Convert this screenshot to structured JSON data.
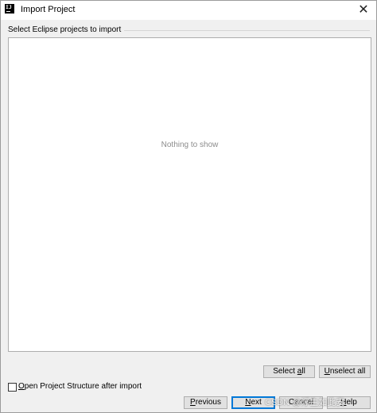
{
  "window": {
    "title": "Import Project",
    "app_icon_text": "IJ",
    "close_glyph": "✕"
  },
  "group": {
    "label": "Select Eclipse projects to import"
  },
  "list": {
    "empty_text": "Nothing to show"
  },
  "selection_buttons": {
    "select_all_pre": "Select ",
    "select_all_mnemonic": "a",
    "select_all_post": "ll",
    "unselect_all_mnemonic": "U",
    "unselect_all_post": "nselect all"
  },
  "checkbox": {
    "mnemonic": "O",
    "label_post": "pen Project Structure after import",
    "checked": false
  },
  "footer_buttons": {
    "previous_mnemonic": "P",
    "previous_post": "revious",
    "next_mnemonic": "N",
    "next_post": "ext",
    "cancel_label": "Cancel",
    "help_mnemonic": "H",
    "help_post": "elp"
  },
  "watermark": {
    "text": "CSDN @浮生如此安"
  },
  "colors": {
    "accent": "#0078d7",
    "window_bg": "#f0f0f0",
    "panel_bg": "#ffffff",
    "empty_text": "#8c8c8c"
  }
}
